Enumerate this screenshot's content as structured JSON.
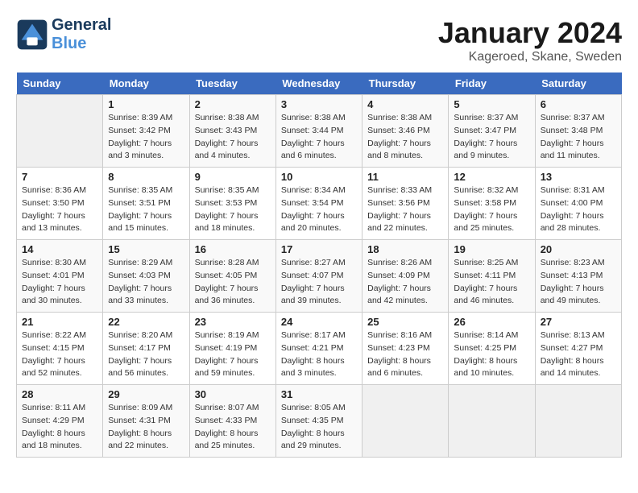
{
  "header": {
    "logo_line1": "General",
    "logo_line2": "Blue",
    "title": "January 2024",
    "location": "Kageroed, Skane, Sweden"
  },
  "days_of_week": [
    "Sunday",
    "Monday",
    "Tuesday",
    "Wednesday",
    "Thursday",
    "Friday",
    "Saturday"
  ],
  "weeks": [
    [
      {
        "day": "",
        "sunrise": "",
        "sunset": "",
        "daylight": ""
      },
      {
        "day": "1",
        "sunrise": "Sunrise: 8:39 AM",
        "sunset": "Sunset: 3:42 PM",
        "daylight": "Daylight: 7 hours and 3 minutes."
      },
      {
        "day": "2",
        "sunrise": "Sunrise: 8:38 AM",
        "sunset": "Sunset: 3:43 PM",
        "daylight": "Daylight: 7 hours and 4 minutes."
      },
      {
        "day": "3",
        "sunrise": "Sunrise: 8:38 AM",
        "sunset": "Sunset: 3:44 PM",
        "daylight": "Daylight: 7 hours and 6 minutes."
      },
      {
        "day": "4",
        "sunrise": "Sunrise: 8:38 AM",
        "sunset": "Sunset: 3:46 PM",
        "daylight": "Daylight: 7 hours and 8 minutes."
      },
      {
        "day": "5",
        "sunrise": "Sunrise: 8:37 AM",
        "sunset": "Sunset: 3:47 PM",
        "daylight": "Daylight: 7 hours and 9 minutes."
      },
      {
        "day": "6",
        "sunrise": "Sunrise: 8:37 AM",
        "sunset": "Sunset: 3:48 PM",
        "daylight": "Daylight: 7 hours and 11 minutes."
      }
    ],
    [
      {
        "day": "7",
        "sunrise": "Sunrise: 8:36 AM",
        "sunset": "Sunset: 3:50 PM",
        "daylight": "Daylight: 7 hours and 13 minutes."
      },
      {
        "day": "8",
        "sunrise": "Sunrise: 8:35 AM",
        "sunset": "Sunset: 3:51 PM",
        "daylight": "Daylight: 7 hours and 15 minutes."
      },
      {
        "day": "9",
        "sunrise": "Sunrise: 8:35 AM",
        "sunset": "Sunset: 3:53 PM",
        "daylight": "Daylight: 7 hours and 18 minutes."
      },
      {
        "day": "10",
        "sunrise": "Sunrise: 8:34 AM",
        "sunset": "Sunset: 3:54 PM",
        "daylight": "Daylight: 7 hours and 20 minutes."
      },
      {
        "day": "11",
        "sunrise": "Sunrise: 8:33 AM",
        "sunset": "Sunset: 3:56 PM",
        "daylight": "Daylight: 7 hours and 22 minutes."
      },
      {
        "day": "12",
        "sunrise": "Sunrise: 8:32 AM",
        "sunset": "Sunset: 3:58 PM",
        "daylight": "Daylight: 7 hours and 25 minutes."
      },
      {
        "day": "13",
        "sunrise": "Sunrise: 8:31 AM",
        "sunset": "Sunset: 4:00 PM",
        "daylight": "Daylight: 7 hours and 28 minutes."
      }
    ],
    [
      {
        "day": "14",
        "sunrise": "Sunrise: 8:30 AM",
        "sunset": "Sunset: 4:01 PM",
        "daylight": "Daylight: 7 hours and 30 minutes."
      },
      {
        "day": "15",
        "sunrise": "Sunrise: 8:29 AM",
        "sunset": "Sunset: 4:03 PM",
        "daylight": "Daylight: 7 hours and 33 minutes."
      },
      {
        "day": "16",
        "sunrise": "Sunrise: 8:28 AM",
        "sunset": "Sunset: 4:05 PM",
        "daylight": "Daylight: 7 hours and 36 minutes."
      },
      {
        "day": "17",
        "sunrise": "Sunrise: 8:27 AM",
        "sunset": "Sunset: 4:07 PM",
        "daylight": "Daylight: 7 hours and 39 minutes."
      },
      {
        "day": "18",
        "sunrise": "Sunrise: 8:26 AM",
        "sunset": "Sunset: 4:09 PM",
        "daylight": "Daylight: 7 hours and 42 minutes."
      },
      {
        "day": "19",
        "sunrise": "Sunrise: 8:25 AM",
        "sunset": "Sunset: 4:11 PM",
        "daylight": "Daylight: 7 hours and 46 minutes."
      },
      {
        "day": "20",
        "sunrise": "Sunrise: 8:23 AM",
        "sunset": "Sunset: 4:13 PM",
        "daylight": "Daylight: 7 hours and 49 minutes."
      }
    ],
    [
      {
        "day": "21",
        "sunrise": "Sunrise: 8:22 AM",
        "sunset": "Sunset: 4:15 PM",
        "daylight": "Daylight: 7 hours and 52 minutes."
      },
      {
        "day": "22",
        "sunrise": "Sunrise: 8:20 AM",
        "sunset": "Sunset: 4:17 PM",
        "daylight": "Daylight: 7 hours and 56 minutes."
      },
      {
        "day": "23",
        "sunrise": "Sunrise: 8:19 AM",
        "sunset": "Sunset: 4:19 PM",
        "daylight": "Daylight: 7 hours and 59 minutes."
      },
      {
        "day": "24",
        "sunrise": "Sunrise: 8:17 AM",
        "sunset": "Sunset: 4:21 PM",
        "daylight": "Daylight: 8 hours and 3 minutes."
      },
      {
        "day": "25",
        "sunrise": "Sunrise: 8:16 AM",
        "sunset": "Sunset: 4:23 PM",
        "daylight": "Daylight: 8 hours and 6 minutes."
      },
      {
        "day": "26",
        "sunrise": "Sunrise: 8:14 AM",
        "sunset": "Sunset: 4:25 PM",
        "daylight": "Daylight: 8 hours and 10 minutes."
      },
      {
        "day": "27",
        "sunrise": "Sunrise: 8:13 AM",
        "sunset": "Sunset: 4:27 PM",
        "daylight": "Daylight: 8 hours and 14 minutes."
      }
    ],
    [
      {
        "day": "28",
        "sunrise": "Sunrise: 8:11 AM",
        "sunset": "Sunset: 4:29 PM",
        "daylight": "Daylight: 8 hours and 18 minutes."
      },
      {
        "day": "29",
        "sunrise": "Sunrise: 8:09 AM",
        "sunset": "Sunset: 4:31 PM",
        "daylight": "Daylight: 8 hours and 22 minutes."
      },
      {
        "day": "30",
        "sunrise": "Sunrise: 8:07 AM",
        "sunset": "Sunset: 4:33 PM",
        "daylight": "Daylight: 8 hours and 25 minutes."
      },
      {
        "day": "31",
        "sunrise": "Sunrise: 8:05 AM",
        "sunset": "Sunset: 4:35 PM",
        "daylight": "Daylight: 8 hours and 29 minutes."
      },
      {
        "day": "",
        "sunrise": "",
        "sunset": "",
        "daylight": ""
      },
      {
        "day": "",
        "sunrise": "",
        "sunset": "",
        "daylight": ""
      },
      {
        "day": "",
        "sunrise": "",
        "sunset": "",
        "daylight": ""
      }
    ]
  ]
}
